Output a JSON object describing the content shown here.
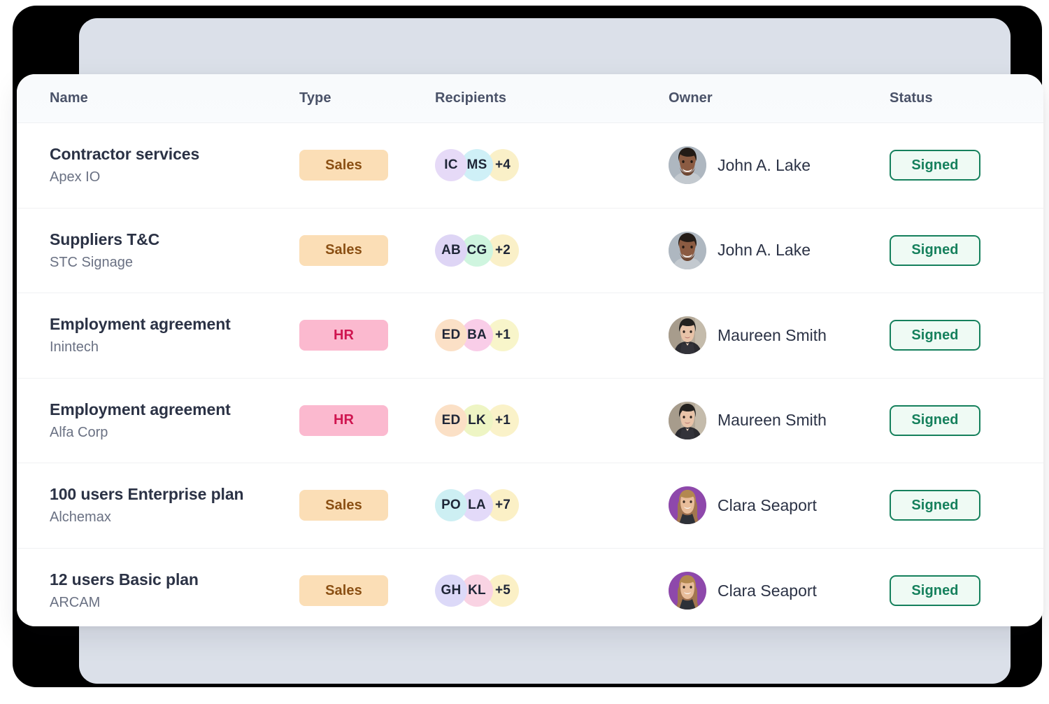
{
  "table": {
    "columns": [
      {
        "key": "name",
        "label": "Name"
      },
      {
        "key": "type",
        "label": "Type"
      },
      {
        "key": "recipients",
        "label": "Recipients"
      },
      {
        "key": "owner",
        "label": "Owner"
      },
      {
        "key": "status",
        "label": "Status"
      }
    ],
    "rows": [
      {
        "title": "Contractor services",
        "company": "Apex IO",
        "type": {
          "label": "Sales",
          "bg": "#FBDEB6",
          "fg": "#8A4F13"
        },
        "recipients": [
          {
            "initials": "IC",
            "bg": "#E6DAF7"
          },
          {
            "initials": "MS",
            "bg": "#CFF0F7"
          },
          {
            "initials": "+4",
            "bg": "#FAF0C8"
          }
        ],
        "owner": {
          "name": "John A. Lake",
          "avatar": "john-a-lake"
        },
        "status": {
          "label": "Signed",
          "fg": "#15805C",
          "bg": "#EFFAF4",
          "border": "#15805C"
        }
      },
      {
        "title": "Suppliers T&C",
        "company": "STC Signage",
        "type": {
          "label": "Sales",
          "bg": "#FBDEB6",
          "fg": "#8A4F13"
        },
        "recipients": [
          {
            "initials": "AB",
            "bg": "#DED5F5"
          },
          {
            "initials": "CG",
            "bg": "#CFF5DF"
          },
          {
            "initials": "+2",
            "bg": "#FAF0C8"
          }
        ],
        "owner": {
          "name": "John A. Lake",
          "avatar": "john-a-lake"
        },
        "status": {
          "label": "Signed",
          "fg": "#15805C",
          "bg": "#EFFAF4",
          "border": "#15805C"
        }
      },
      {
        "title": "Employment agreement",
        "company": "Inintech",
        "type": {
          "label": "HR",
          "bg": "#FBB9CF",
          "fg": "#CF1550"
        },
        "recipients": [
          {
            "initials": "ED",
            "bg": "#FBE0C6"
          },
          {
            "initials": "BA",
            "bg": "#F9CDE8"
          },
          {
            "initials": "+1",
            "bg": "#F8F5CA"
          }
        ],
        "owner": {
          "name": "Maureen Smith",
          "avatar": "maureen-smith"
        },
        "status": {
          "label": "Signed",
          "fg": "#15805C",
          "bg": "#EFFAF4",
          "border": "#15805C"
        }
      },
      {
        "title": "Employment agreement",
        "company": "Alfa Corp",
        "type": {
          "label": "HR",
          "bg": "#FBB9CF",
          "fg": "#CF1550"
        },
        "recipients": [
          {
            "initials": "ED",
            "bg": "#FBE0C6"
          },
          {
            "initials": "LK",
            "bg": "#EEF5C4"
          },
          {
            "initials": "+1",
            "bg": "#FAF2C9"
          }
        ],
        "owner": {
          "name": "Maureen Smith",
          "avatar": "maureen-smith"
        },
        "status": {
          "label": "Signed",
          "fg": "#15805C",
          "bg": "#EFFAF4",
          "border": "#15805C"
        }
      },
      {
        "title": "100 users Enterprise plan",
        "company": "Alchemax",
        "type": {
          "label": "Sales",
          "bg": "#FBDEB6",
          "fg": "#8A4F13"
        },
        "recipients": [
          {
            "initials": "PO",
            "bg": "#CDEFF3"
          },
          {
            "initials": "LA",
            "bg": "#E3DAF9"
          },
          {
            "initials": "+7",
            "bg": "#FBF0C6"
          }
        ],
        "owner": {
          "name": "Clara Seaport",
          "avatar": "clara-seaport"
        },
        "status": {
          "label": "Signed",
          "fg": "#15805C",
          "bg": "#EFFAF4",
          "border": "#15805C"
        }
      },
      {
        "title": "12 users Basic plan",
        "company": "ARCAM",
        "type": {
          "label": "Sales",
          "bg": "#FBDEB6",
          "fg": "#8A4F13"
        },
        "recipients": [
          {
            "initials": "GH",
            "bg": "#DCD9F8"
          },
          {
            "initials": "KL",
            "bg": "#F9D3E3"
          },
          {
            "initials": "+5",
            "bg": "#FBF0C6"
          }
        ],
        "owner": {
          "name": "Clara Seaport",
          "avatar": "clara-seaport"
        },
        "status": {
          "label": "Signed",
          "fg": "#15805C",
          "bg": "#EFFAF4",
          "border": "#15805C"
        }
      }
    ]
  },
  "theme": {
    "page_bg": "#FFFFFF",
    "frame_dark": "#000000",
    "frame_panel": "#DBE0E9",
    "card_bg": "#FFFFFF",
    "header_bg": "#F8FAFC",
    "divider": "#F0F1F3",
    "title_color": "#2B3245",
    "sub_color": "#6A7183",
    "header_text_color": "#4A5268"
  }
}
